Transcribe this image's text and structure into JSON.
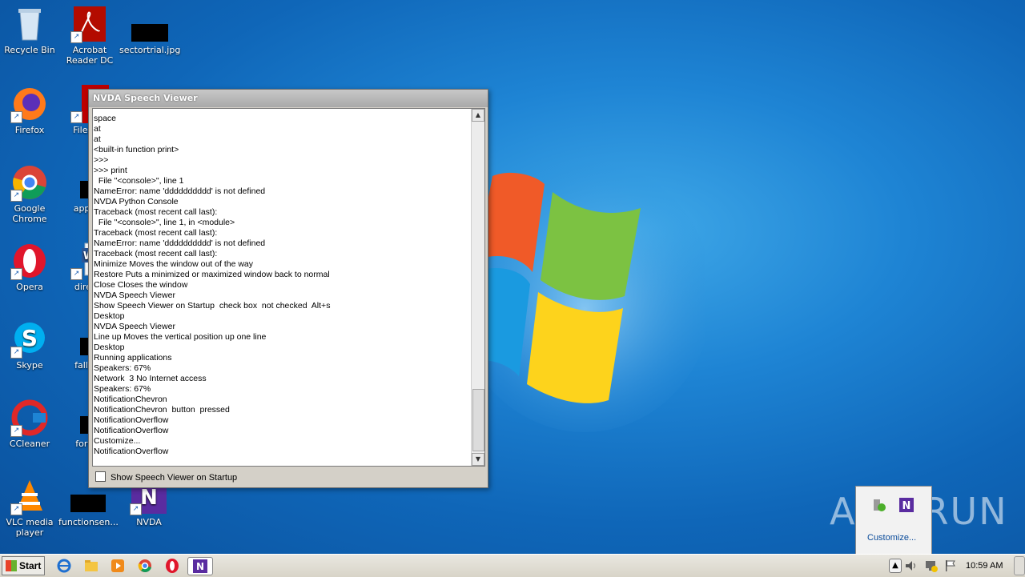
{
  "desktop": {
    "icons": [
      {
        "label": "Recycle Bin"
      },
      {
        "label": "Acrobat Reader DC"
      },
      {
        "label": "sectortrial.jpg"
      },
      {
        "label": "Firefox"
      },
      {
        "label": "FileZilla"
      },
      {
        "label": "Google Chrome"
      },
      {
        "label": "applied"
      },
      {
        "label": "Opera"
      },
      {
        "label": "directa"
      },
      {
        "label": "Skype"
      },
      {
        "label": "fallstat"
      },
      {
        "label": "CCleaner"
      },
      {
        "label": "forwar"
      },
      {
        "label": "VLC media player"
      },
      {
        "label": "functionsen..."
      },
      {
        "label": "NVDA"
      }
    ],
    "watermark": "ANY RUN"
  },
  "speech_viewer": {
    "title": "NVDA Speech Viewer",
    "lines": [
      "space",
      "at",
      "at",
      "<built-in function print>",
      ">>>",
      ">>> print",
      "  File \"<console>\", line 1",
      "NameError: name 'dddddddddd' is not defined",
      "NVDA Python Console",
      "Traceback (most recent call last):",
      "  File \"<console>\", line 1, in <module>",
      "Traceback (most recent call last):",
      "NameError: name 'dddddddddd' is not defined",
      "Traceback (most recent call last):",
      "Minimize Moves the window out of the way",
      "Restore Puts a minimized or maximized window back to normal",
      "Close Closes the window",
      "NVDA Speech Viewer",
      "Show Speech Viewer on Startup  check box  not checked  Alt+s",
      "Desktop",
      "NVDA Speech Viewer",
      "Line up Moves the vertical position up one line",
      "Desktop",
      "Running applications",
      "Speakers: 67%",
      "Network  3 No Internet access",
      "Speakers: 67%",
      "NotificationChevron",
      "NotificationChevron  button  pressed",
      "NotificationOverflow",
      "NotificationOverflow",
      "Customize...",
      "NotificationOverflow"
    ],
    "checkbox_label": "Show Speech Viewer on Startup",
    "checkbox_checked": false
  },
  "overflow_popup": {
    "customize_label": "Customize..."
  },
  "taskbar": {
    "start_label": "Start",
    "clock": "10:59 AM"
  }
}
